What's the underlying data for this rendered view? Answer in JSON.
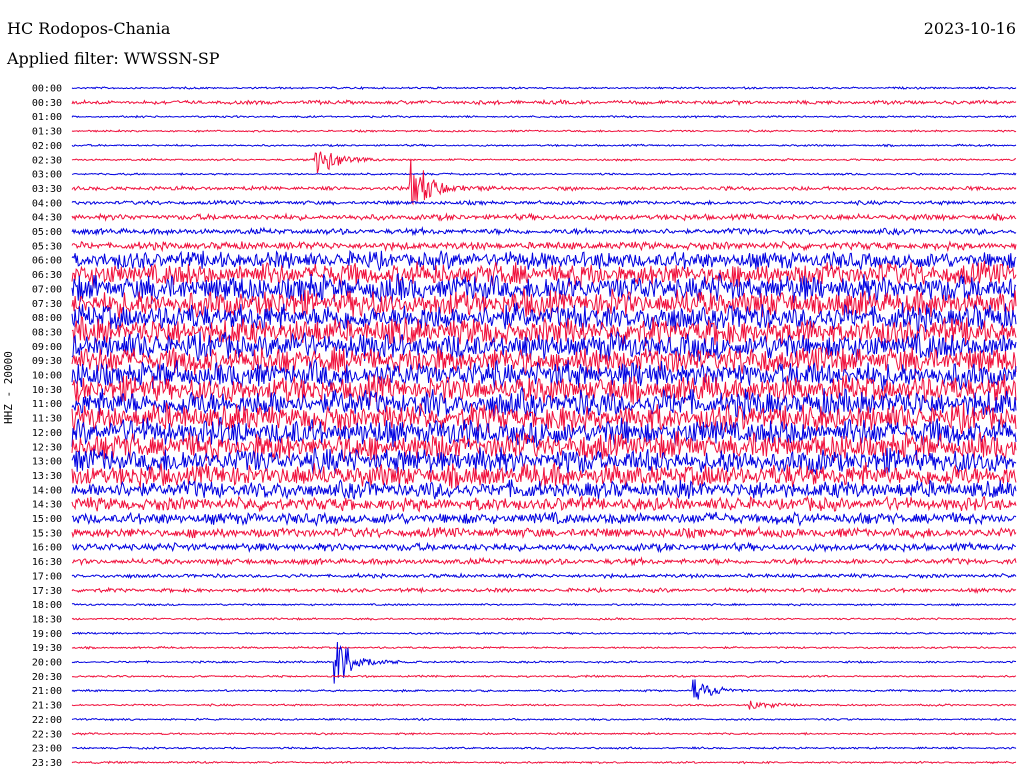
{
  "header": {
    "station": "HC Rodopos-Chania",
    "date": "2023-10-16",
    "filter": "Applied filter: WWSSN-SP"
  },
  "axis": {
    "channel_label": "HHZ - 20000"
  },
  "colors": {
    "trace_a": "#0000e0",
    "trace_b": "#f0103c"
  },
  "chart_data": {
    "type": "line",
    "title": "HC Rodopos-Chania",
    "ylabel": "HHZ - 20000",
    "rows": [
      "00:00",
      "00:30",
      "01:00",
      "01:30",
      "02:00",
      "02:30",
      "03:00",
      "03:30",
      "04:00",
      "04:30",
      "05:00",
      "05:30",
      "06:00",
      "06:30",
      "07:00",
      "07:30",
      "08:00",
      "08:30",
      "09:00",
      "09:30",
      "10:00",
      "10:30",
      "11:00",
      "11:30",
      "12:00",
      "12:30",
      "13:00",
      "13:30",
      "14:00",
      "14:30",
      "15:00",
      "15:30",
      "16:00",
      "16:30",
      "17:00",
      "17:30",
      "18:00",
      "18:30",
      "19:00",
      "19:30",
      "20:00",
      "20:30",
      "21:00",
      "21:30",
      "22:00",
      "22:30",
      "23:00",
      "23:30"
    ],
    "noise_level": [
      1,
      2,
      1,
      1,
      1,
      1,
      1,
      2,
      2,
      3,
      3,
      4,
      9,
      12,
      14,
      14,
      14,
      14,
      14,
      14,
      14,
      14,
      14,
      14,
      14,
      14,
      13,
      12,
      9,
      7,
      6,
      5,
      4,
      3,
      2,
      2,
      1,
      1,
      1,
      1,
      1,
      1,
      1,
      1,
      1,
      1,
      1,
      1
    ],
    "events": [
      {
        "row": "02:30",
        "x_fraction": 0.26,
        "amplitude": 26
      },
      {
        "row": "03:30",
        "x_fraction": 0.36,
        "amplitude": 34
      },
      {
        "row": "20:00",
        "x_fraction": 0.28,
        "amplitude": 40
      },
      {
        "row": "21:00",
        "x_fraction": 0.66,
        "amplitude": 14
      },
      {
        "row": "21:30",
        "x_fraction": 0.72,
        "amplitude": 6
      }
    ]
  }
}
